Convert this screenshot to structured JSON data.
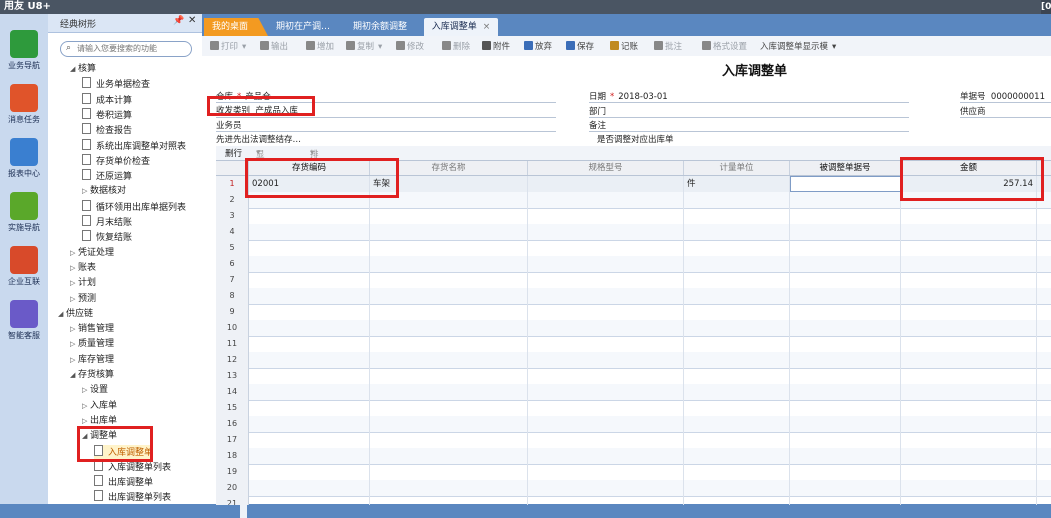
{
  "window": {
    "app_title": "用友 U8+",
    "corner": "[0"
  },
  "nav": [
    {
      "label": "业务导航",
      "color": "#2e9a3c",
      "icon": "tree-nav-icon"
    },
    {
      "label": "消息任务",
      "color": "#e0542a",
      "icon": "message-icon"
    },
    {
      "label": "报表中心",
      "color": "#3a7fd0",
      "icon": "report-icon"
    },
    {
      "label": "实施导航",
      "color": "#5aa82a",
      "icon": "compass-icon"
    },
    {
      "label": "企业互联",
      "color": "#d84a2a",
      "icon": "connect-icon"
    },
    {
      "label": "智能客服",
      "color": "#6a5ac8",
      "icon": "service-icon"
    }
  ],
  "tree": {
    "header": "经典树形",
    "search_placeholder": "请输入您要搜索的功能",
    "items": [
      {
        "label": "核算",
        "type": "folder-open",
        "indent": 1
      },
      {
        "label": "业务单据检查",
        "type": "doc",
        "indent": 2
      },
      {
        "label": "成本计算",
        "type": "doc",
        "indent": 2
      },
      {
        "label": "卷积运算",
        "type": "doc",
        "indent": 2
      },
      {
        "label": "检查报告",
        "type": "doc",
        "indent": 2
      },
      {
        "label": "系统出库调整单对照表",
        "type": "doc",
        "indent": 2
      },
      {
        "label": "存货单价检查",
        "type": "doc",
        "indent": 2
      },
      {
        "label": "还原运算",
        "type": "doc",
        "indent": 2
      },
      {
        "label": "数据核对",
        "type": "folder",
        "indent": 2
      },
      {
        "label": "循环领用出库单据列表",
        "type": "doc",
        "indent": 2
      },
      {
        "label": "月末结账",
        "type": "doc",
        "indent": 2
      },
      {
        "label": "恢复结账",
        "type": "doc",
        "indent": 2
      },
      {
        "label": "凭证处理",
        "type": "folder",
        "indent": 1
      },
      {
        "label": "账表",
        "type": "folder",
        "indent": 1
      },
      {
        "label": "计划",
        "type": "folder",
        "indent": 1
      },
      {
        "label": "预测",
        "type": "folder",
        "indent": 1
      },
      {
        "label": "供应链",
        "type": "folder-open",
        "indent": 0
      },
      {
        "label": "销售管理",
        "type": "folder",
        "indent": 1
      },
      {
        "label": "质量管理",
        "type": "folder",
        "indent": 1
      },
      {
        "label": "库存管理",
        "type": "folder",
        "indent": 1
      },
      {
        "label": "存货核算",
        "type": "folder-open",
        "indent": 1
      },
      {
        "label": "设置",
        "type": "folder",
        "indent": 2
      },
      {
        "label": "入库单",
        "type": "folder",
        "indent": 2
      },
      {
        "label": "出库单",
        "type": "folder",
        "indent": 2
      },
      {
        "label": "调整单",
        "type": "folder-open",
        "indent": 2
      },
      {
        "label": "入库调整单",
        "type": "doc",
        "indent": 3,
        "selected": true
      },
      {
        "label": "入库调整单列表",
        "type": "doc",
        "indent": 3
      },
      {
        "label": "出库调整单",
        "type": "doc",
        "indent": 3
      },
      {
        "label": "出库调整单列表",
        "type": "doc",
        "indent": 3
      }
    ]
  },
  "tabs": [
    {
      "label": "我的桌面"
    },
    {
      "label": "期初在产调…"
    },
    {
      "label": "期初余额调整"
    },
    {
      "label": "入库调整单",
      "active": true,
      "close": "×"
    }
  ],
  "toolbar": [
    {
      "label": "打印",
      "icon": "print-icon",
      "disabled": true,
      "caret": "▾"
    },
    {
      "label": "输出",
      "icon": "export-icon",
      "disabled": true
    },
    {
      "label": "增加",
      "icon": "add-icon",
      "disabled": true
    },
    {
      "label": "复制",
      "icon": "copy-icon",
      "disabled": true,
      "caret": "▾"
    },
    {
      "label": "修改",
      "icon": "edit-icon",
      "disabled": true
    },
    {
      "label": "删除",
      "icon": "delete-icon",
      "disabled": true
    },
    {
      "label": "附件",
      "icon": "attach-icon",
      "disabled": false
    },
    {
      "label": "放弃",
      "icon": "abandon-icon",
      "disabled": false
    },
    {
      "label": "保存",
      "icon": "save-icon",
      "disabled": false
    },
    {
      "label": "记账",
      "icon": "post-icon",
      "disabled": false
    },
    {
      "label": "批注",
      "icon": "note-icon",
      "disabled": true
    },
    {
      "label": "格式设置",
      "icon": "format-icon",
      "disabled": true
    },
    {
      "label": "入库调整单显示模",
      "icon": "",
      "disabled": false,
      "caret": "▾"
    }
  ],
  "form": {
    "title": "入库调整单",
    "fields": {
      "warehouse_label": "仓库",
      "warehouse_value": "产品仓",
      "date_label": "日期",
      "date_value": "2018-03-01",
      "docno_label": "单据号",
      "docno_value": "0000000011",
      "rd_type_label": "收发类别",
      "rd_type_value": "产成品入库",
      "dept_label": "部门",
      "supplier_label": "供应商",
      "clerk_label": "业务员",
      "memo_label": "备注",
      "fifo_label": "先进先出法调整结存…",
      "outbound_label": "是否调整对应出库单"
    },
    "required_mark": "*",
    "grid_toolbar": {
      "delete_row": "删行",
      "display_format": "显示格式",
      "sort_locate": "排序定位",
      "caret": "▾"
    },
    "columns": [
      {
        "label": "存货编码"
      },
      {
        "label": "存货名称"
      },
      {
        "label": "规格型号"
      },
      {
        "label": "计量单位"
      },
      {
        "label": "被调整单据号"
      },
      {
        "label": "金额"
      }
    ],
    "rows": [
      {
        "no": "1",
        "code": "02001",
        "name": "车架",
        "spec": "",
        "unit": "件",
        "ref": "",
        "amount": "257.14"
      },
      {
        "no": "2"
      },
      {
        "no": "3"
      },
      {
        "no": "4"
      },
      {
        "no": "5"
      },
      {
        "no": "6"
      },
      {
        "no": "7"
      },
      {
        "no": "8"
      },
      {
        "no": "9"
      },
      {
        "no": "10"
      },
      {
        "no": "11"
      },
      {
        "no": "12"
      },
      {
        "no": "13"
      },
      {
        "no": "14"
      },
      {
        "no": "15"
      },
      {
        "no": "16"
      },
      {
        "no": "17"
      },
      {
        "no": "18"
      },
      {
        "no": "19"
      },
      {
        "no": "20"
      },
      {
        "no": "21"
      }
    ]
  },
  "colors": {
    "annotation": "#e02020",
    "tab_active": "#f39a21",
    "panel_blue": "#5a87c0"
  }
}
